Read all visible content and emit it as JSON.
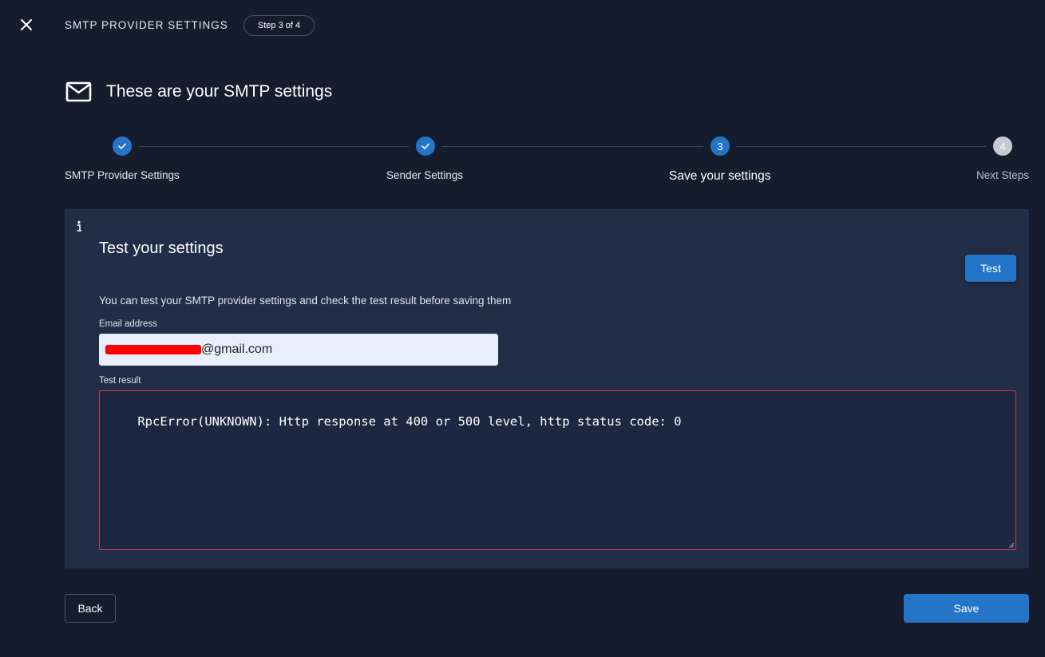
{
  "header": {
    "title": "SMTP PROVIDER SETTINGS",
    "step_indicator": "Step 3 of 4",
    "close_icon": "close-icon"
  },
  "page": {
    "heading": "These are your SMTP settings",
    "heading_icon": "mail-icon"
  },
  "stepper": {
    "steps": [
      {
        "label": "SMTP Provider Settings",
        "state": "done",
        "marker": ""
      },
      {
        "label": "Sender Settings",
        "state": "done",
        "marker": ""
      },
      {
        "label": "Save your settings",
        "state": "active",
        "marker": "3"
      },
      {
        "label": "Next Steps",
        "state": "todo",
        "marker": "4"
      }
    ]
  },
  "test_card": {
    "info_icon": "info-icon",
    "title": "Test your settings",
    "test_button": "Test",
    "description": "You can test your SMTP provider settings and check the test result before saving them",
    "email_label": "Email address",
    "email_visible_suffix": "@gmail.com",
    "result_label": "Test result",
    "result_text": "RpcError(UNKNOWN): Http response at 400 or 500 level, http status code: 0"
  },
  "footer": {
    "back_button": "Back",
    "save_button": "Save"
  },
  "colors": {
    "background": "#151c2e",
    "card": "#222d48",
    "accent": "#2474c8",
    "error_border": "#d33a52",
    "redaction": "#ff0000"
  }
}
